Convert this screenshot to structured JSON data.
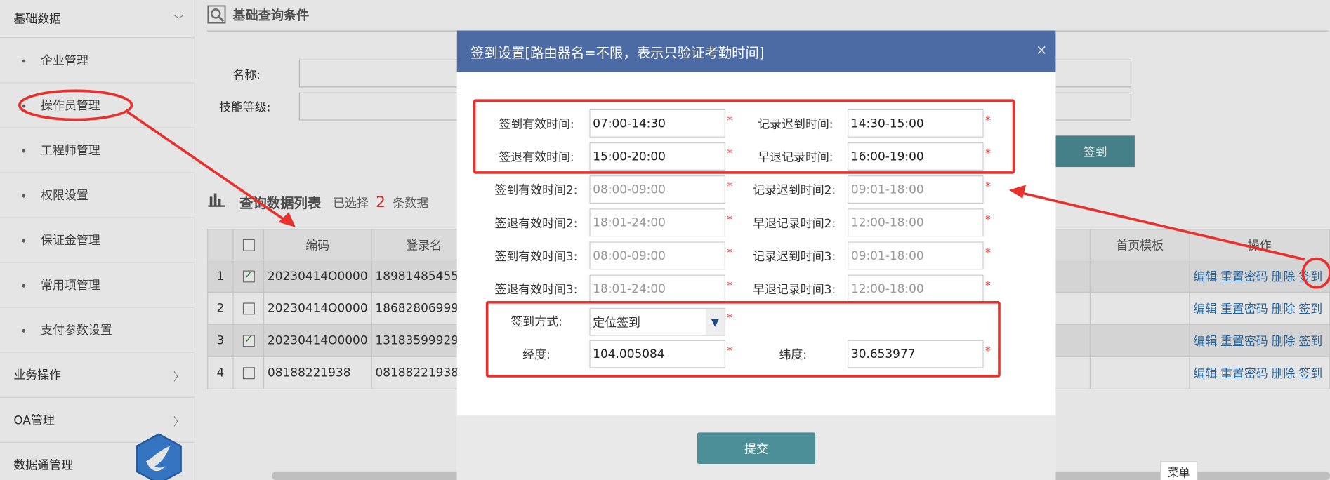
{
  "sidebar": {
    "group_basic": "基础数据",
    "items": [
      "企业管理",
      "操作员管理",
      "工程师管理",
      "权限设置",
      "保证金管理",
      "常用项管理",
      "支付参数设置"
    ],
    "group_business": "业务操作",
    "group_oa": "OA管理",
    "group_datacomm": "数据通管理"
  },
  "search": {
    "title": "基础查询条件",
    "name_label": "名称:",
    "skill_label": "技能等级:",
    "signin_button": "签到"
  },
  "list": {
    "title": "查询数据列表",
    "selected_prefix": "已选择",
    "selected_count": "2",
    "selected_suffix": "条数据",
    "columns": [
      "编码",
      "登录名",
      "首页模板",
      "操作"
    ],
    "rows": [
      {
        "index": "1",
        "checked": true,
        "code": "20230414O0000",
        "login": "18981485455"
      },
      {
        "index": "2",
        "checked": false,
        "code": "20230414O0000",
        "login": "18682806999"
      },
      {
        "index": "3",
        "checked": true,
        "code": "20230414O0000",
        "login": "13183599929"
      },
      {
        "index": "4",
        "checked": false,
        "code": "08188221938",
        "login": "08188221938"
      }
    ],
    "ops": {
      "edit": "编辑",
      "reset": "重置密码",
      "delete": "删除",
      "signin": "签到"
    }
  },
  "modal": {
    "title": "签到设置[路由器名=不限，表示只验证考勤时间]",
    "close": "×",
    "fields": {
      "checkin_valid": {
        "label": "签到有效时间:",
        "value": "07:00-14:30"
      },
      "late_record": {
        "label": "记录迟到时间:",
        "value": "14:30-15:00"
      },
      "checkout_valid": {
        "label": "签退有效时间:",
        "value": "15:00-20:00"
      },
      "early_record": {
        "label": "早退记录时间:",
        "value": "16:00-19:00"
      },
      "checkin_valid2": {
        "label": "签到有效时间2:",
        "placeholder": "08:00-09:00"
      },
      "late_record2": {
        "label": "记录迟到时间2:",
        "placeholder": "09:01-18:00"
      },
      "checkout_valid2": {
        "label": "签退有效时间2:",
        "placeholder": "18:01-24:00"
      },
      "early_record2": {
        "label": "早退记录时间2:",
        "placeholder": "12:00-18:00"
      },
      "checkin_valid3": {
        "label": "签到有效时间3:",
        "placeholder": "08:00-09:00"
      },
      "late_record3": {
        "label": "记录迟到时间3:",
        "placeholder": "09:01-18:00"
      },
      "checkout_valid3": {
        "label": "签退有效时间3:",
        "placeholder": "18:01-24:00"
      },
      "early_record3": {
        "label": "早退记录时间3:",
        "placeholder": "12:00-18:00"
      },
      "method": {
        "label": "签到方式:",
        "value": "定位签到"
      },
      "longitude": {
        "label": "经度:",
        "value": "104.005084"
      },
      "latitude": {
        "label": "纬度:",
        "value": "30.653977"
      }
    },
    "required_mark": "*",
    "submit": "提交"
  },
  "menu_tag": "菜单",
  "colors": {
    "header_blue": "#4c6ba5",
    "teal": "#4d8f99",
    "red": "#e8302d",
    "link": "#2a6fb0"
  }
}
